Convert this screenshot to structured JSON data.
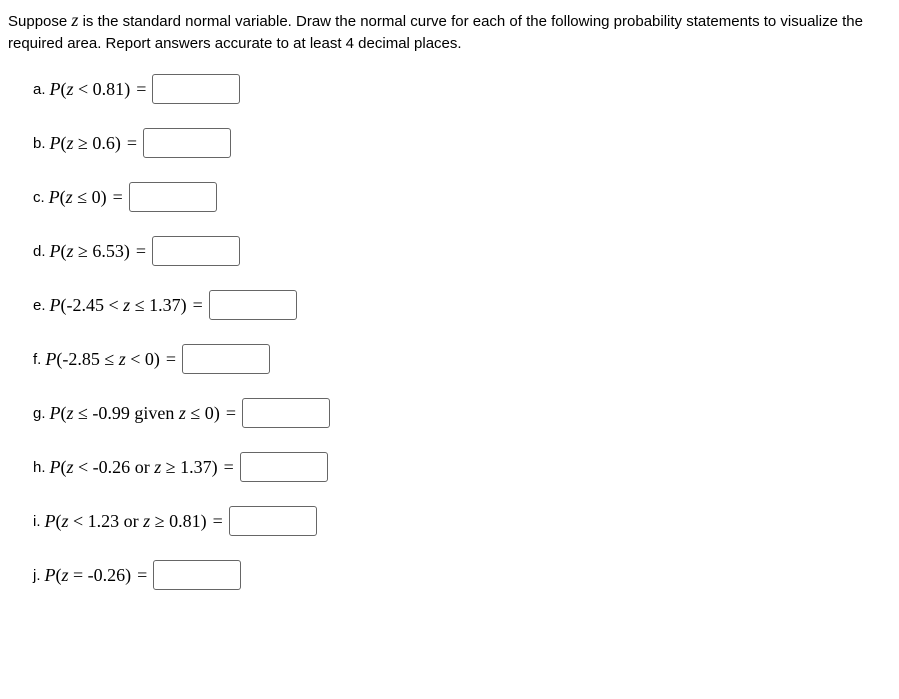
{
  "intro_line1": "Suppose ",
  "intro_z": "z",
  "intro_line2": " is the standard normal variable. Draw the normal curve for each of the following probability statements to visualize the required area. Report answers accurate to at least 4 decimal places.",
  "questions": {
    "a": {
      "label": "a. ",
      "expr_pre": "P",
      "expr_open": "(",
      "expr_var": "z",
      "expr_op": " < 0.81",
      "expr_close": ")"
    },
    "b": {
      "label": "b. ",
      "expr_pre": "P",
      "expr_open": "(",
      "expr_var": "z",
      "expr_op": " ≥ 0.6",
      "expr_close": ")"
    },
    "c": {
      "label": "c. ",
      "expr_pre": "P",
      "expr_open": "(",
      "expr_var": "z",
      "expr_op": " ≤ 0",
      "expr_close": ")"
    },
    "d": {
      "label": "d. ",
      "expr_pre": "P",
      "expr_open": "(",
      "expr_var": "z",
      "expr_op": " ≥ 6.53",
      "expr_close": ")"
    },
    "e": {
      "label": "e. ",
      "expr_pre": "P",
      "expr_open": "(",
      "expr_left": "-2.45 < ",
      "expr_var": "z",
      "expr_op": " ≤ 1.37",
      "expr_close": ")"
    },
    "f": {
      "label": "f. ",
      "expr_pre": "P",
      "expr_open": "(",
      "expr_left": "-2.85 ≤ ",
      "expr_var": "z",
      "expr_op": " < 0",
      "expr_close": ")"
    },
    "g": {
      "label": "g. ",
      "expr_pre": "P",
      "expr_open": "(",
      "expr_var": "z",
      "expr_op": " ≤ -0.99 ",
      "given_word": " given ",
      "expr_var2": " z",
      "expr_op2": " ≤ 0",
      "expr_close": ")"
    },
    "h": {
      "label": "h. ",
      "expr_pre": "P",
      "expr_open": "(",
      "expr_var": "z",
      "expr_op": " < -0.26",
      "or_word": " or ",
      "expr_var2": " z",
      "expr_op2": " ≥ 1.37",
      "expr_close": ")"
    },
    "i": {
      "label": "i. ",
      "expr_pre": "P",
      "expr_open": "(",
      "expr_var": "z",
      "expr_op": " < 1.23",
      "or_word": " or ",
      "expr_var2": " z",
      "expr_op2": " ≥ 0.81",
      "expr_close": ")"
    },
    "j": {
      "label": "j. ",
      "expr_pre": "P",
      "expr_open": "(",
      "expr_var": "z",
      "expr_op": " = -0.26",
      "expr_close": ")"
    }
  },
  "equals": "="
}
